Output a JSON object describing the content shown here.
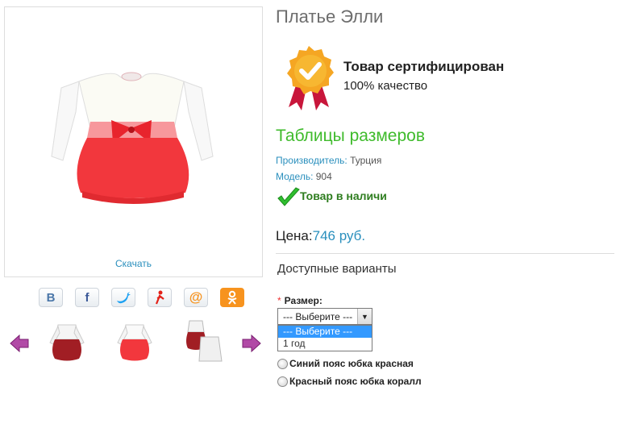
{
  "product": {
    "title": "Платье Элли",
    "download_link": "Скачать"
  },
  "certificate": {
    "title": "Товар сертифицирован",
    "subtitle": "100% качество"
  },
  "size_tables_link": "Таблицы размеров",
  "meta": {
    "manufacturer_label": "Производитель:",
    "manufacturer_value": "Турция",
    "model_label": "Модель:",
    "model_value": "904"
  },
  "stock_status": "Товар в наличи",
  "price": {
    "label": "Цена:",
    "value": "746 руб."
  },
  "variants": {
    "heading": "Доступные варианты",
    "size_required_mark": "*",
    "size_label": "Размер:",
    "size_select_value": "--- Выберите ---",
    "size_options": [
      "--- Выберите ---",
      "1 год"
    ],
    "radio_options": [
      "Синий пояс юбка красная",
      "Красный пояс юбка коралл"
    ]
  },
  "share_buttons": [
    {
      "icon": "vk-icon",
      "glyph": "В",
      "color": "#4a76a8"
    },
    {
      "icon": "facebook-icon",
      "glyph": "f",
      "color": "#3b5998"
    },
    {
      "icon": "twitter-icon",
      "glyph": "🐦",
      "color": "#1da1f2"
    },
    {
      "icon": "moikrug-icon",
      "glyph": "Я",
      "color": "#e32118"
    },
    {
      "icon": "mailru-icon",
      "glyph": "@",
      "color": "#f7931e"
    },
    {
      "icon": "odnoklassniki-icon",
      "glyph": "ок",
      "color": "#ffffff"
    }
  ],
  "colors": {
    "accent_blue": "#2a8fbd",
    "green_link": "#3fbb2c",
    "dress_red": "#f2373d",
    "arrow_purple": "#9b2c8f"
  }
}
